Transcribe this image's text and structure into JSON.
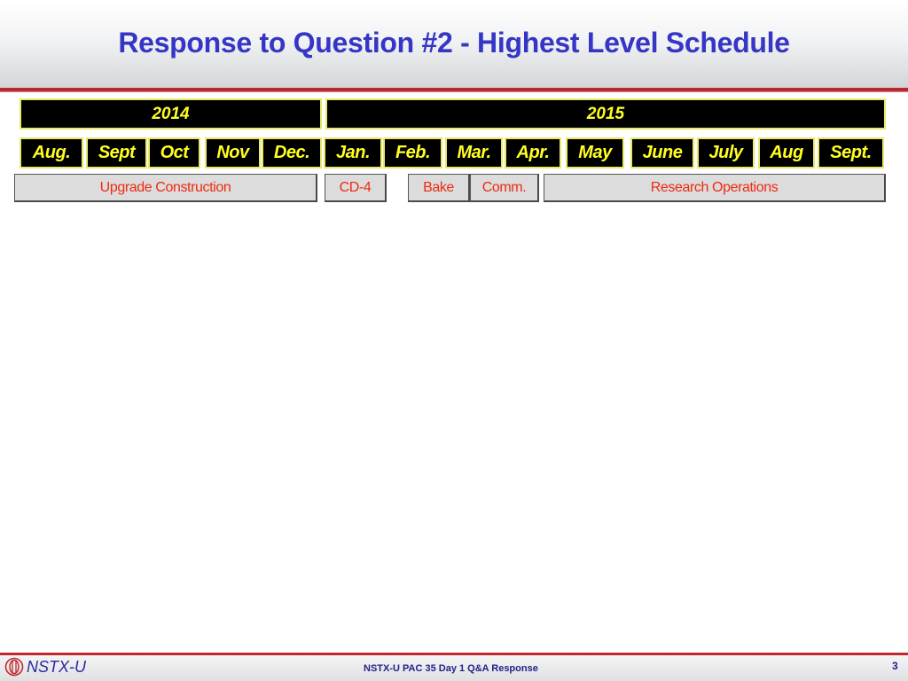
{
  "slide": {
    "title": "Response to Question #2 - Highest Level Schedule",
    "years": [
      "2014",
      "2015"
    ],
    "months": [
      "Aug.",
      "Sept",
      "Oct",
      "Nov",
      "Dec.",
      "Jan.",
      "Feb.",
      "Mar.",
      "Apr.",
      "May",
      "June",
      "July",
      "Aug",
      "Sept."
    ],
    "phases": [
      "Upgrade Construction",
      "CD-4",
      "Bake",
      "Comm.",
      "Research Operations"
    ]
  },
  "footer": {
    "logo_text": "NSTX-U",
    "logo_icon": "nstx-logo-icon",
    "center_text": "NSTX-U PAC 35 Day 1 Q&A Response",
    "page_number": "3"
  },
  "colors": {
    "title": "#3535c6",
    "accent_rule": "#c0282e",
    "month_text": "#ffff22",
    "month_bg": "#000000",
    "phase_text": "#ee2a12",
    "phase_bg": "#dcdcdc"
  }
}
